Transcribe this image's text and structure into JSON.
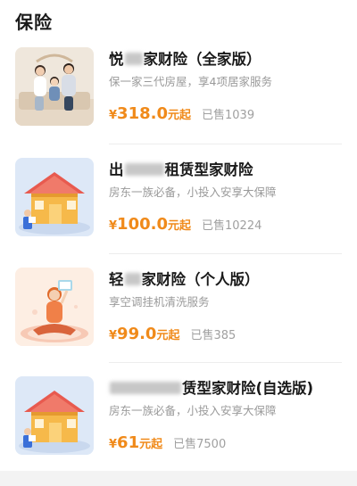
{
  "section": {
    "title": "保险"
  },
  "products": [
    {
      "name_prefix": "悦",
      "name_visible": "家财险（全家版）",
      "description": "保一家三代房屋，享4项居家服务",
      "price_currency": "¥",
      "price_amount": "318.0",
      "price_suffix": "元起",
      "sold": "已售1039",
      "icon": "family-photo"
    },
    {
      "name_prefix": "出",
      "name_visible": "租赁型家财险",
      "description": "房东一族必备，小投入安享大保障",
      "price_currency": "¥",
      "price_amount": "100.0",
      "price_suffix": "元起",
      "sold": "已售10224",
      "icon": "house-illustration"
    },
    {
      "name_prefix": "轻",
      "name_visible": "家财险（个人版）",
      "description": "享空调挂机清洗服务",
      "price_currency": "¥",
      "price_amount": "99.0",
      "price_suffix": "元起",
      "sold": "已售385",
      "icon": "woman-illustration"
    },
    {
      "name_prefix": "",
      "name_visible": "赁型家财险(自选版)",
      "description": "房东一族必备，小投入安享大保障",
      "price_currency": "¥",
      "price_amount": "61",
      "price_suffix": "元起",
      "sold": "已售7500",
      "icon": "house-illustration"
    }
  ],
  "colors": {
    "price": "#f08a1a",
    "muted": "#9a9a9a",
    "title": "#1a1a1a"
  }
}
